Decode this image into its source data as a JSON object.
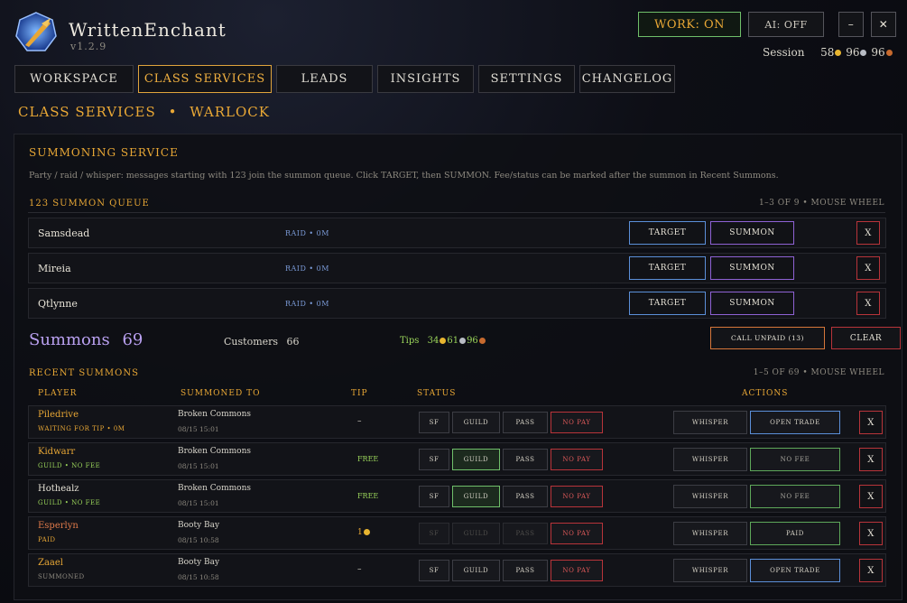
{
  "app": {
    "title": "WrittenEnchant",
    "version": "v1.2.9"
  },
  "top": {
    "work": "WORK: ON",
    "ai": "AI: OFF",
    "minimize": "–",
    "close": "✕",
    "session_label": "Session",
    "session_gold": "58",
    "session_silver": "96",
    "session_copper": "96"
  },
  "nav": [
    "WORKSPACE",
    "CLASS SERVICES",
    "LEADS",
    "INSIGHTS",
    "SETTINGS",
    "CHANGELOG"
  ],
  "breadcrumb": {
    "section": "CLASS SERVICES",
    "sep": "•",
    "page": "WARLOCK"
  },
  "service": {
    "title": "SUMMONING SERVICE",
    "desc": "Party / raid / whisper: messages starting with 123 join the summon queue. Click TARGET, then SUMMON. Fee/status can be marked after the summon in Recent Summons."
  },
  "queue": {
    "title": "123 SUMMON QUEUE",
    "info": "1–3 OF 9 • MOUSE WHEEL",
    "target": "TARGET",
    "summon": "SUMMON",
    "remove": "X",
    "rows": [
      {
        "name": "Samsdead",
        "meta": "RAID • 0M"
      },
      {
        "name": "Mireia",
        "meta": "RAID • 0M"
      },
      {
        "name": "Qtlynne",
        "meta": "RAID • 0M"
      }
    ]
  },
  "stats": {
    "summons_label": "Summons",
    "summons": "69",
    "customers_label": "Customers",
    "customers": "66",
    "tips_label": "Tips",
    "tips_gold": "34",
    "tips_silver": "61",
    "tips_copper": "96",
    "call_unpaid": "CALL UNPAID (13)",
    "clear": "CLEAR"
  },
  "recent": {
    "title": "RECENT SUMMONS",
    "info": "1–5 OF 69 • MOUSE WHEEL",
    "headers": {
      "player": "PLAYER",
      "to": "SUMMONED TO",
      "tip": "TIP",
      "status": "STATUS",
      "actions": "ACTIONS"
    },
    "status_labels": {
      "sf": "SF",
      "guild": "GUILD",
      "pass": "PASS",
      "nopay": "NO PAY"
    },
    "whisper": "WHISPER",
    "remove": "X",
    "rows": [
      {
        "name": "Piledrive",
        "sub": "WAITING FOR TIP • 0M",
        "to": "Broken Commons",
        "time": "08/15 15:01",
        "tip": "–",
        "action": "OPEN TRADE"
      },
      {
        "name": "Kidwarr",
        "sub": "GUILD • NO FEE",
        "to": "Broken Commons",
        "time": "08/15 15:01",
        "tip": "FREE",
        "action": "NO FEE"
      },
      {
        "name": "Hothealz",
        "sub": "GUILD • NO FEE",
        "to": "Broken Commons",
        "time": "08/15 15:01",
        "tip": "FREE",
        "action": "NO FEE"
      },
      {
        "name": "Esperlyn",
        "sub": "PAID",
        "to": "Booty Bay",
        "time": "08/15 10:58",
        "tip": "1",
        "action": "PAID"
      },
      {
        "name": "Zaael",
        "sub": "SUMMONED",
        "to": "Booty Bay",
        "time": "08/15 10:58",
        "tip": "–",
        "action": "OPEN TRADE"
      }
    ]
  },
  "colors": {
    "accent": "#e8a735",
    "summons": "#b9a0f0",
    "tips": "#9ad45a",
    "work_border": "#6fbf6a",
    "target": "#5b8fd8",
    "summon": "#8e62d4",
    "remove": "#b8343a"
  },
  "icons": {
    "logo": "quill-orb-icon",
    "gold": "gold-coin-icon",
    "silver": "silver-coin-icon",
    "copper": "copper-coin-icon"
  }
}
